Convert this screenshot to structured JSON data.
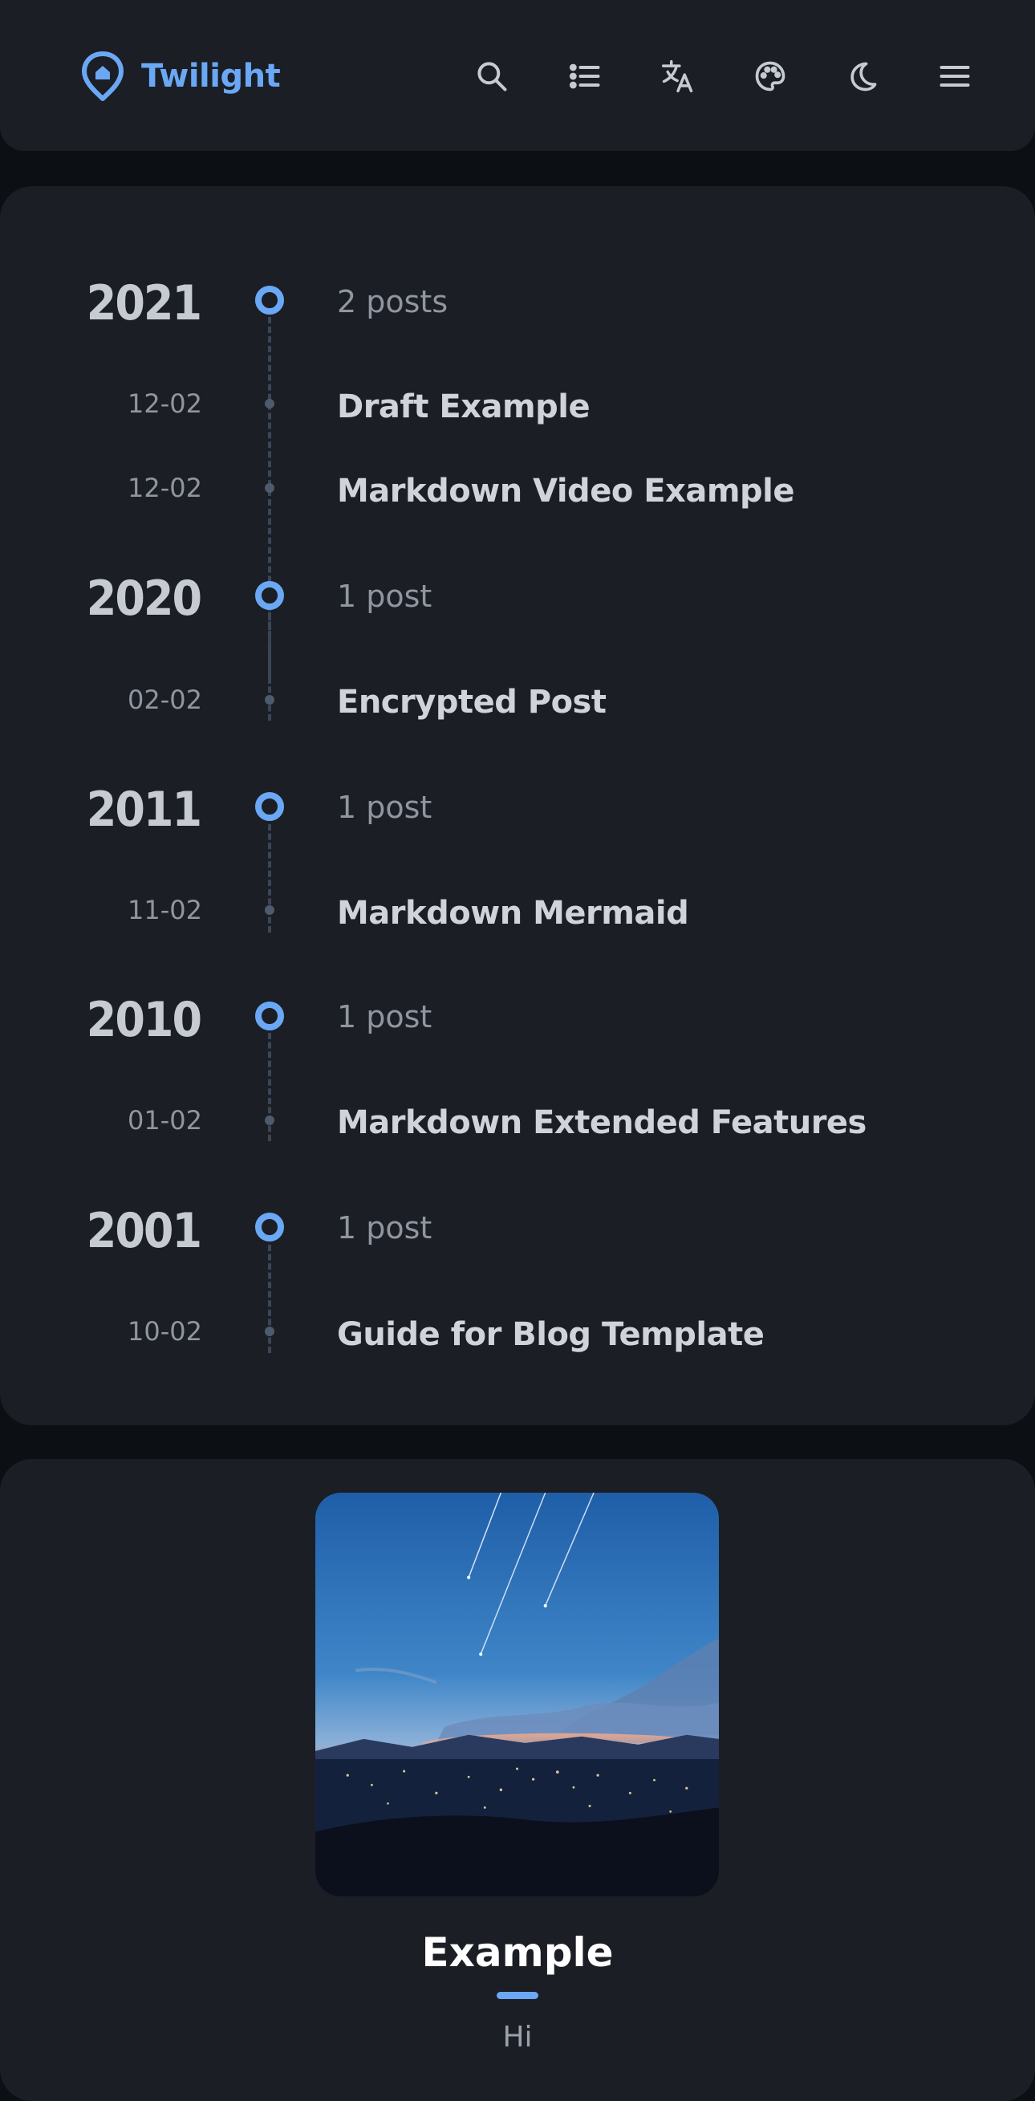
{
  "navbar": {
    "brand_name": "Twilight",
    "icons": [
      "location-pin-icon",
      "search-icon",
      "list-icon",
      "translate-icon",
      "palette-icon",
      "moon-icon",
      "menu-icon"
    ],
    "accent_color": "#6aa8f5"
  },
  "archive": {
    "groups": [
      {
        "year": "2021",
        "count": "2 posts",
        "posts": [
          {
            "date": "12-02",
            "title": "Draft Example"
          },
          {
            "date": "12-02",
            "title": "Markdown Video Example"
          }
        ]
      },
      {
        "year": "2020",
        "count": "1 post",
        "posts": [
          {
            "date": "02-02",
            "title": "Encrypted Post"
          }
        ]
      },
      {
        "year": "2011",
        "count": "1 post",
        "posts": [
          {
            "date": "11-02",
            "title": "Markdown Mermaid"
          }
        ]
      },
      {
        "year": "2010",
        "count": "1 post",
        "posts": [
          {
            "date": "01-02",
            "title": "Markdown Extended Features"
          }
        ]
      },
      {
        "year": "2001",
        "count": "1 post",
        "posts": [
          {
            "date": "10-02",
            "title": "Guide for Blog Template"
          }
        ]
      }
    ]
  },
  "profile": {
    "name": "Example",
    "bio": "Hi"
  }
}
